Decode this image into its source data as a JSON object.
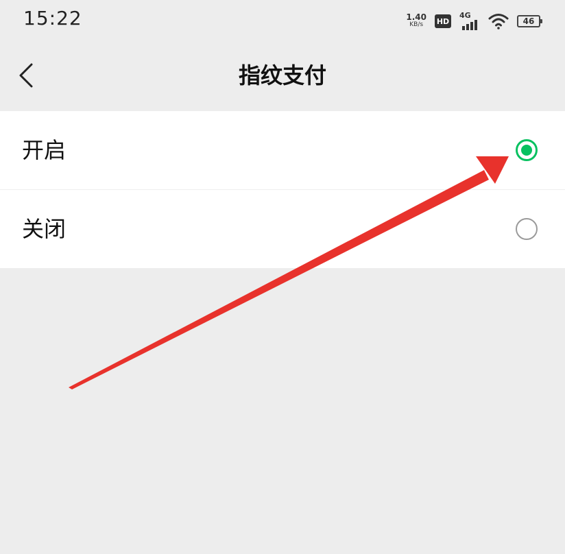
{
  "status_bar": {
    "time": "15:22",
    "net_speed_value": "1.40",
    "net_speed_unit": "KB/s",
    "hd_label": "HD",
    "network_type": "4G",
    "battery_level": "46",
    "icons": [
      "hd-icon",
      "cellular-signal-icon",
      "wifi-icon",
      "battery-icon"
    ]
  },
  "nav": {
    "back_icon": "chevron-left-icon",
    "title": "指纹支付"
  },
  "options": [
    {
      "label": "开启",
      "selected": true
    },
    {
      "label": "关闭",
      "selected": false
    }
  ],
  "colors": {
    "background": "#ededed",
    "accent_green": "#07c160",
    "annotation_red": "#e8322c"
  }
}
